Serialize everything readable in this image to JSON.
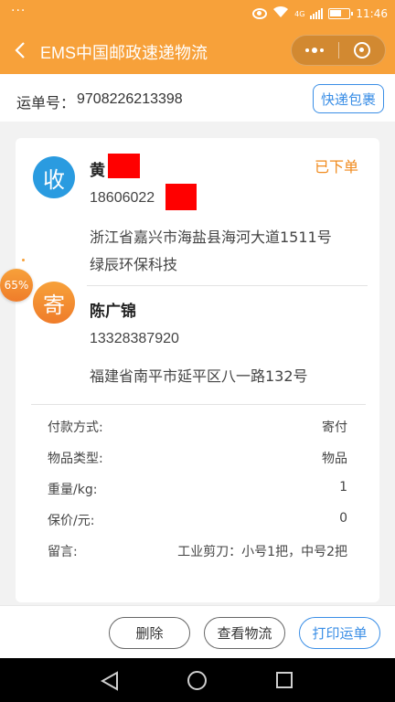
{
  "status_bar": {
    "time": "11:46",
    "network": "4G",
    "icons": [
      "eye-icon",
      "wifi-icon",
      "signal-icon",
      "battery-icon"
    ]
  },
  "header": {
    "title": "EMS中国邮政速递物流",
    "back_icon": "chevron-left-icon",
    "more_icon": "more-dots-icon",
    "close_icon": "target-close-icon"
  },
  "waybill": {
    "label": "运单号：",
    "number": "9708226213398",
    "parcel_button": "快递包裹"
  },
  "order": {
    "status": "已下单",
    "receiver": {
      "avatar_char": "收",
      "name": "黄",
      "phone": "18606022",
      "address_line1": "浙江省嘉兴市海盐县海河大道1511号",
      "address_line2": "绿辰环保科技"
    },
    "sender": {
      "avatar_char": "寄",
      "name": "陈广锦",
      "phone": "13328387920",
      "address_line1": "福建省南平市延平区八一路132号"
    },
    "details": [
      {
        "key": "付款方式:",
        "value": "寄付"
      },
      {
        "key": "物品类型:",
        "value": "物品"
      },
      {
        "key": "重量/kg:",
        "value": "1"
      },
      {
        "key": "保价/元:",
        "value": "0"
      },
      {
        "key": "留言:",
        "value": "工业剪刀：小号1把，中号2把"
      }
    ]
  },
  "floating_badge": {
    "text": "65%"
  },
  "actions": {
    "delete": "删除",
    "track": "查看物流",
    "print": "打印运单"
  },
  "colors": {
    "brand_orange": "#f7a13a",
    "status_orange": "#f08a1d",
    "accent_blue": "#3a8ee6",
    "receiver_blue": "#2a9be0",
    "redaction_red": "#ff0000"
  }
}
